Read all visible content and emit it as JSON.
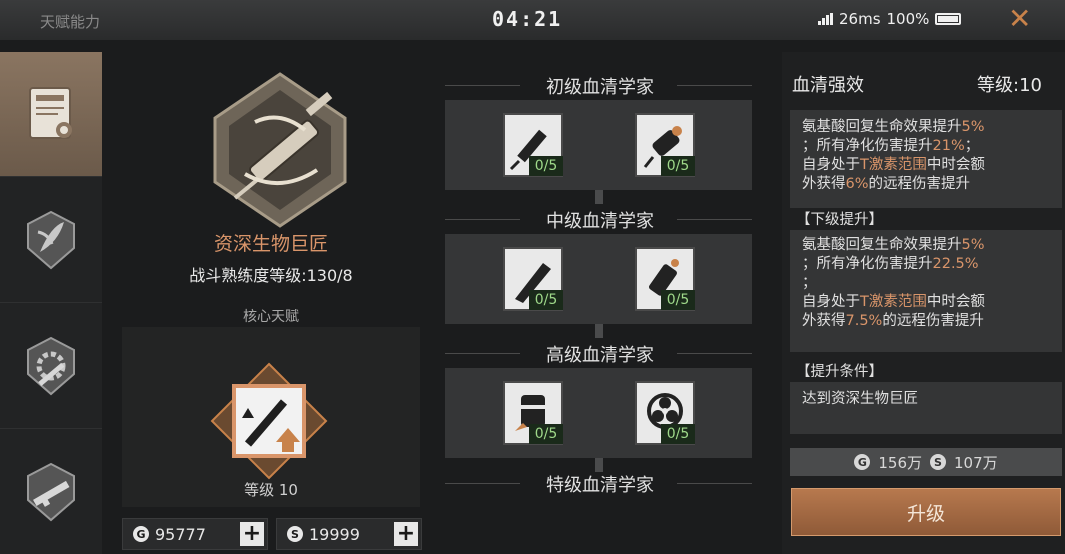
{
  "header": {
    "title": "天赋能力",
    "time": "04:21",
    "ping": "26ms",
    "battery": "100%"
  },
  "sidebar": {
    "tabs": [
      {
        "name": "certificate-tab",
        "active": true
      },
      {
        "name": "plant-tab",
        "active": false
      },
      {
        "name": "engineering-tab",
        "active": false
      },
      {
        "name": "weapon-tab",
        "active": false
      }
    ]
  },
  "profile": {
    "title": "资深生物巨匠",
    "mastery": "战斗熟练度等级:130/8",
    "core_label": "核心天赋",
    "core_level": "等级 10"
  },
  "currency": {
    "gold_value": "95777",
    "silver_value": "19999"
  },
  "tree": {
    "tiers": [
      {
        "label": "初级血清学家",
        "skills": [
          {
            "count": "0/5",
            "icon": "syringe-icon"
          },
          {
            "count": "0/5",
            "icon": "injector-icon"
          }
        ]
      },
      {
        "label": "中级血清学家",
        "skills": [
          {
            "count": "0/5",
            "icon": "dart-icon"
          },
          {
            "count": "0/5",
            "icon": "vial-icon"
          }
        ]
      },
      {
        "label": "高级血清学家",
        "skills": [
          {
            "count": "0/5",
            "icon": "barrel-icon"
          },
          {
            "count": "0/5",
            "icon": "biohazard-icon"
          }
        ]
      },
      {
        "label": "特级血清学家"
      }
    ]
  },
  "details": {
    "title": "血清强效",
    "level": "等级:10",
    "current": {
      "line1_pre": "氨基酸回复生命效果提升",
      "line1_val": "5%",
      "line2_pre": "；所有净化伤害提升",
      "line2_val": "21%",
      "line2_post": "；",
      "line3_pre": "自身处于",
      "line3_hl": "T激素范围",
      "line3_post": "中时会额",
      "line4_pre": "外获得",
      "line4_val": "6%",
      "line4_post": "的远程伤害提升"
    },
    "next_label": "【下级提升】",
    "next": {
      "line1_pre": "氨基酸回复生命效果提升",
      "line1_val": "5%",
      "line2_pre": "；所有净化伤害提升",
      "line2_val": "22.5%",
      "line3": "；",
      "line4_pre": "自身处于",
      "line4_hl": "T激素范围",
      "line4_post": "中时会额",
      "line5_pre": "外获得",
      "line5_val": "7.5%",
      "line5_post": "的远程伤害提升"
    },
    "condition_label": "【提升条件】",
    "condition_text": "达到资深生物巨匠",
    "cost_gold": "156万",
    "cost_silver": "107万",
    "upgrade_label": "升级"
  },
  "colors": {
    "accent": "#d9956a",
    "count_green": "#9fd98a",
    "upgrade_button": "#a86c45"
  }
}
